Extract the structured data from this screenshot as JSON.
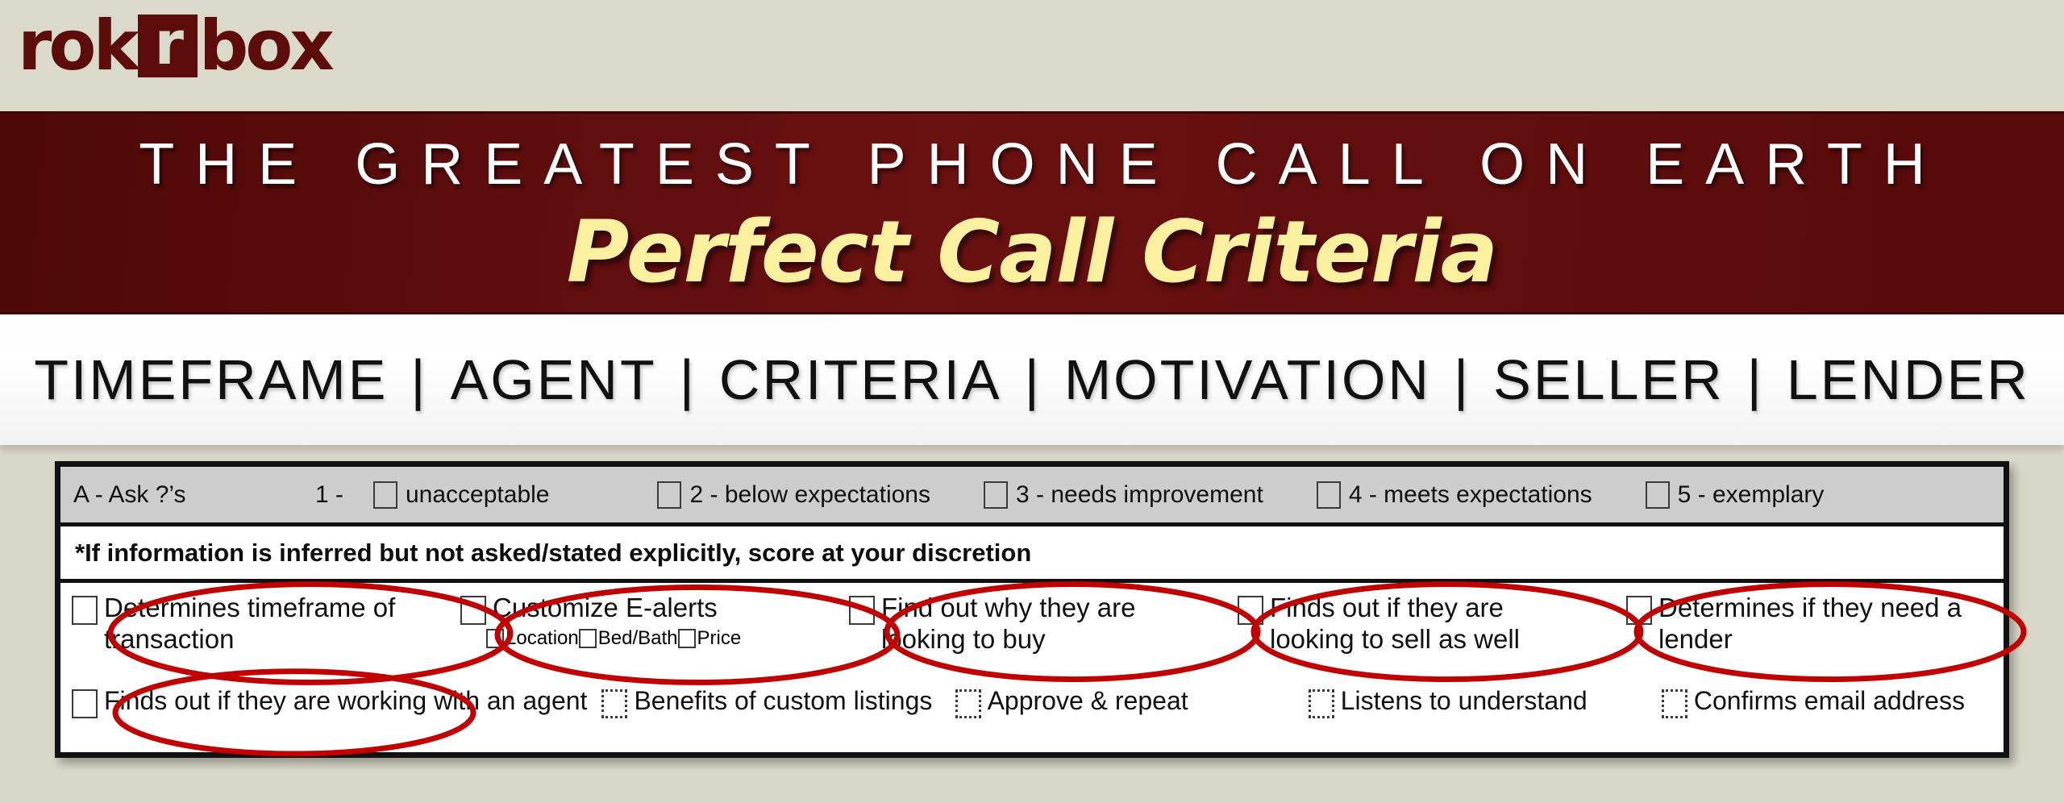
{
  "brand": {
    "logo_prefix": "rok",
    "logo_mark": "r",
    "logo_suffix": "box",
    "logo_color": "#5d0c0c"
  },
  "banner": {
    "title": "THE GREATEST PHONE CALL ON EARTH",
    "subtitle": "Perfect Call Criteria",
    "background_color": "#600d0d",
    "title_color": "#ffffff",
    "subtitle_color": "#fbf0a0"
  },
  "nav": {
    "items": [
      "TIMEFRAME",
      "AGENT",
      "CRITERIA",
      "MOTIVATION",
      "SELLER",
      "LENDER"
    ],
    "separator": "|"
  },
  "legend": {
    "ask_label": "A - Ask ?’s",
    "one_prefix": "1 -",
    "options": [
      {
        "label": "unacceptable",
        "checked": false
      },
      {
        "label": "2 - below expectations",
        "checked": false
      },
      {
        "label": "3 - needs improvement",
        "checked": false
      },
      {
        "label": "4 - meets expectations",
        "checked": false
      },
      {
        "label": "5 - exemplary",
        "checked": false
      }
    ],
    "background_color": "#cdcdcd"
  },
  "note": {
    "text": "*If information is inferred but not asked/stated explicitly, score at your discretion"
  },
  "checklist": {
    "row1": [
      {
        "label": "Determines timeframe of transaction",
        "checked": false,
        "circled": true,
        "box_style": "solid"
      },
      {
        "label": "Customize E-alerts",
        "checked": false,
        "circled": true,
        "box_style": "solid",
        "sub_options": [
          {
            "label": "Location",
            "checked": false
          },
          {
            "label": "Bed/Bath",
            "checked": false
          },
          {
            "label": "Price",
            "checked": false
          }
        ]
      },
      {
        "label": "Find out why they are looking to buy",
        "checked": false,
        "circled": true,
        "box_style": "solid"
      },
      {
        "label": "Finds out if they are looking to sell as well",
        "checked": false,
        "circled": true,
        "box_style": "solid"
      },
      {
        "label": "Determines if they need a lender",
        "checked": false,
        "circled": true,
        "box_style": "solid"
      }
    ],
    "row2": [
      {
        "label": "Finds out if they are working with an agent",
        "checked": false,
        "circled": true,
        "box_style": "solid"
      },
      {
        "label": "Benefits of custom listings",
        "checked": false,
        "circled": false,
        "box_style": "dotted"
      },
      {
        "label": "Approve & repeat",
        "checked": false,
        "circled": false,
        "box_style": "dotted"
      },
      {
        "label": "Listens to understand",
        "checked": false,
        "circled": false,
        "box_style": "dotted"
      },
      {
        "label": "Confirms email address",
        "checked": false,
        "circled": false,
        "box_style": "dotted"
      }
    ]
  },
  "annotation": {
    "color": "#c00000",
    "shape": "ellipse",
    "count": 6
  }
}
